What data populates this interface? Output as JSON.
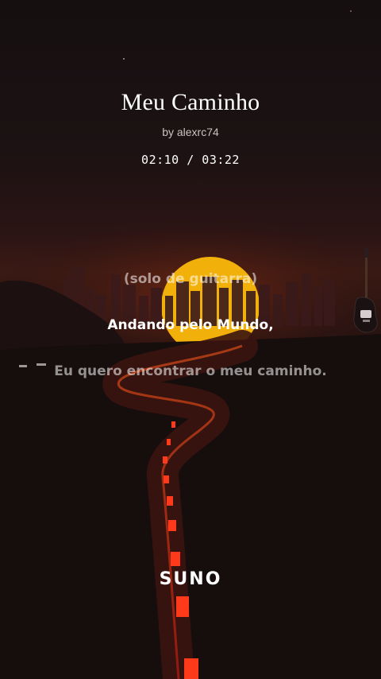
{
  "song": {
    "title": "Meu Caminho",
    "artist": "by alexrc74",
    "time": "02:10 / 03:22",
    "progress": 0.644
  },
  "lyrics": [
    {
      "text": "(solo de guitarra)",
      "active": false
    },
    {
      "text": "Andando pelo Mundo,",
      "active": true
    },
    {
      "text": "Eu quero encontrar o meu caminho.",
      "active": false
    }
  ],
  "brand": {
    "logo": "SUNO"
  },
  "colors": {
    "background": "#140d0d",
    "sun": "#f5b400",
    "road_marks": "#ff3a1a",
    "lyric_active": "#ffffff",
    "lyric_inactive": "#9a8f8f"
  },
  "icons": [
    "electric-guitar-icon"
  ]
}
